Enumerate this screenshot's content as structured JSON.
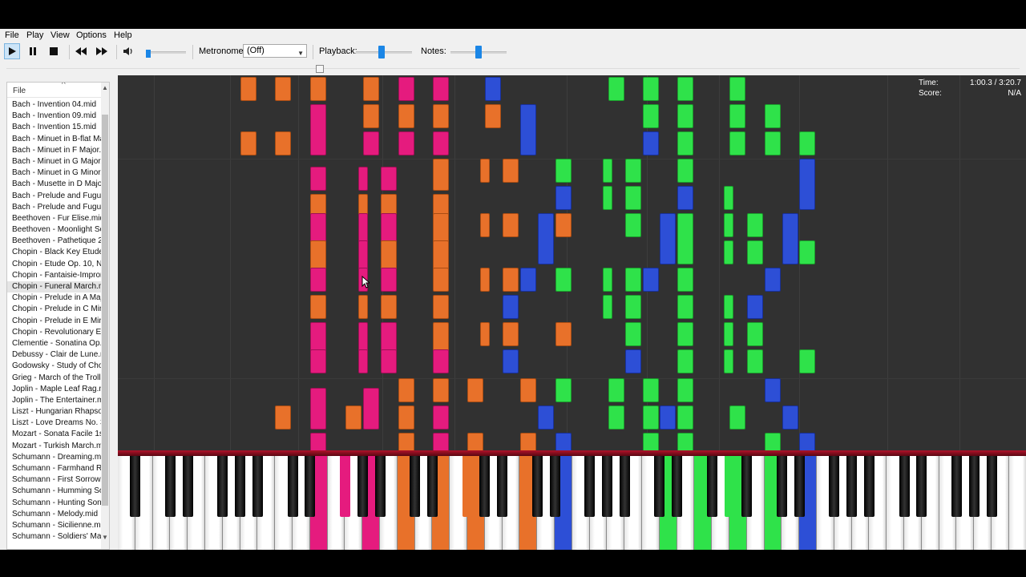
{
  "menu": [
    "File",
    "Play",
    "View",
    "Options",
    "Help"
  ],
  "toolbar": {
    "metronome_label": "Metronome:",
    "metronome_value": "(Off)",
    "playback_label": "Playback:",
    "notes_label": "Notes:",
    "playback_level": 0.45,
    "notes_level": 0.5,
    "volume_level": 0.1
  },
  "file_panel": {
    "header": "File",
    "items": [
      "Bach - Invention 04.mid",
      "Bach - Invention 09.mid",
      "Bach - Invention 15.mid",
      "Bach - Minuet in B-flat Maj",
      "Bach - Minuet in F Major.m",
      "Bach - Minuet in G Major.m",
      "Bach - Minuet in G Minor.m",
      "Bach - Musette in D Major.",
      "Bach - Prelude and Fugue i",
      "Bach - Prelude and Fugue i",
      "Beethoven - Fur Elise.mid",
      "Beethoven - Moonlight Sor",
      "Beethoven - Pathetique 2r",
      "Chopin - Black Key Etude.n",
      "Chopin - Etude Op. 10, No",
      "Chopin - Fantaisie-Improm",
      "Chopin - Funeral March.mi",
      "Chopin - Prelude in A Majo",
      "Chopin - Prelude in C Minor",
      "Chopin - Prelude in E Minor",
      "Chopin - Revolutionary Etu",
      "Clementie - Sonatina Op. 3",
      "Debussy - Clair de Lune.mi",
      "Godowsky - Study of Chop",
      "Grieg - March of the Trolls.",
      "Joplin - Maple Leaf Rag.mi",
      "Joplin - The Entertainer.mi",
      "Liszt - Hungarian Rhapsody",
      "Liszt - Love Dreams No. 3.",
      "Mozart - Sonata Facile 1st",
      "Mozart - Turkish March.mi",
      "Schumann - Dreaming.mid",
      "Schumann - Farmhand Rup",
      "Schumann - First Sorrow.m",
      "Schumann - Humming Song",
      "Schumann - Hunting Song.",
      "Schumann - Melody.mid",
      "Schumann - Sicilienne.mid",
      "Schumann - Soldiers' March"
    ],
    "selected_index": 16
  },
  "info": {
    "time_label": "Time:",
    "time_value": "1:00.3 / 3:20.7",
    "score_label": "Score:",
    "score_value": "N/A"
  },
  "colors": {
    "orange": "#e8712a",
    "pink": "#e51b7e",
    "blue": "#2d4fd6",
    "green": "#2fe24a",
    "roll_background": "#313131"
  },
  "icons": {
    "play": "play-icon",
    "pause": "pause-icon",
    "stop": "stop-icon",
    "rewind": "rewind-icon",
    "forward": "fast-forward-icon",
    "volume": "speaker-icon"
  }
}
